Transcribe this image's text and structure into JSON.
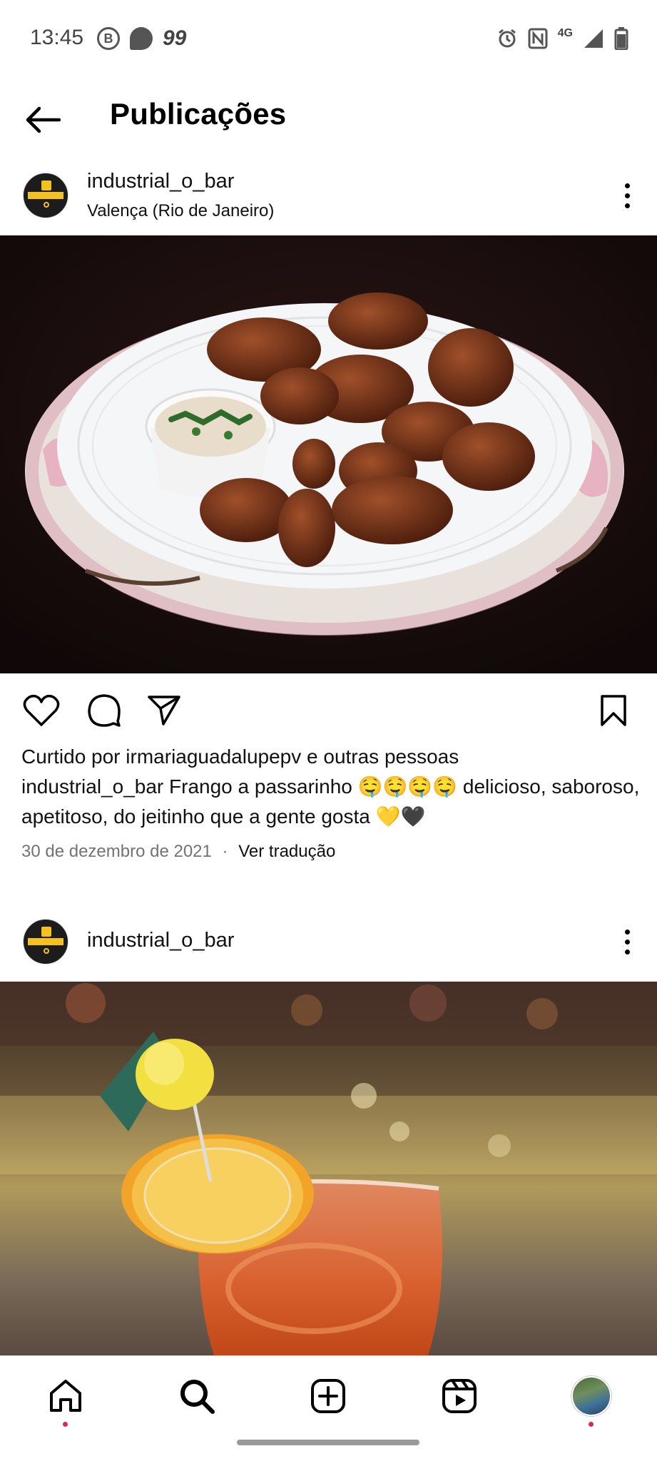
{
  "status_bar": {
    "time": "13:45",
    "left_icons": [
      "b-icon",
      "chat-bubble-icon"
    ],
    "notification_count": "99",
    "network": "4G"
  },
  "header": {
    "title": "Publicações"
  },
  "posts": [
    {
      "username": "industrial_o_bar",
      "location": "Valença (Rio de Janeiro)",
      "image_desc_icon": "food-photo",
      "liked_by_prefix": "Curtido por ",
      "liked_by_user": "irmariaguadalupepv",
      "liked_by_suffix": " e outras pessoas",
      "caption_user": "industrial_o_bar",
      "caption_text": " Frango a passarinho 🤤🤤🤤🤤 delicioso, saboroso, apetitoso, do jeitinho que a gente gosta 💛🖤",
      "date": "30 de dezembro de 2021",
      "separator": "·",
      "translate": "Ver tradução"
    },
    {
      "username": "industrial_o_bar",
      "image_desc_icon": "drink-photo"
    }
  ],
  "avatar_text": "INDUSTRIAL O BAR",
  "bottom_nav": [
    "home-icon",
    "search-icon",
    "create-icon",
    "reels-icon",
    "profile-avatar"
  ],
  "colors": {
    "notification_dot": "#e0245e",
    "brand_yellow": "#f4c21a"
  }
}
